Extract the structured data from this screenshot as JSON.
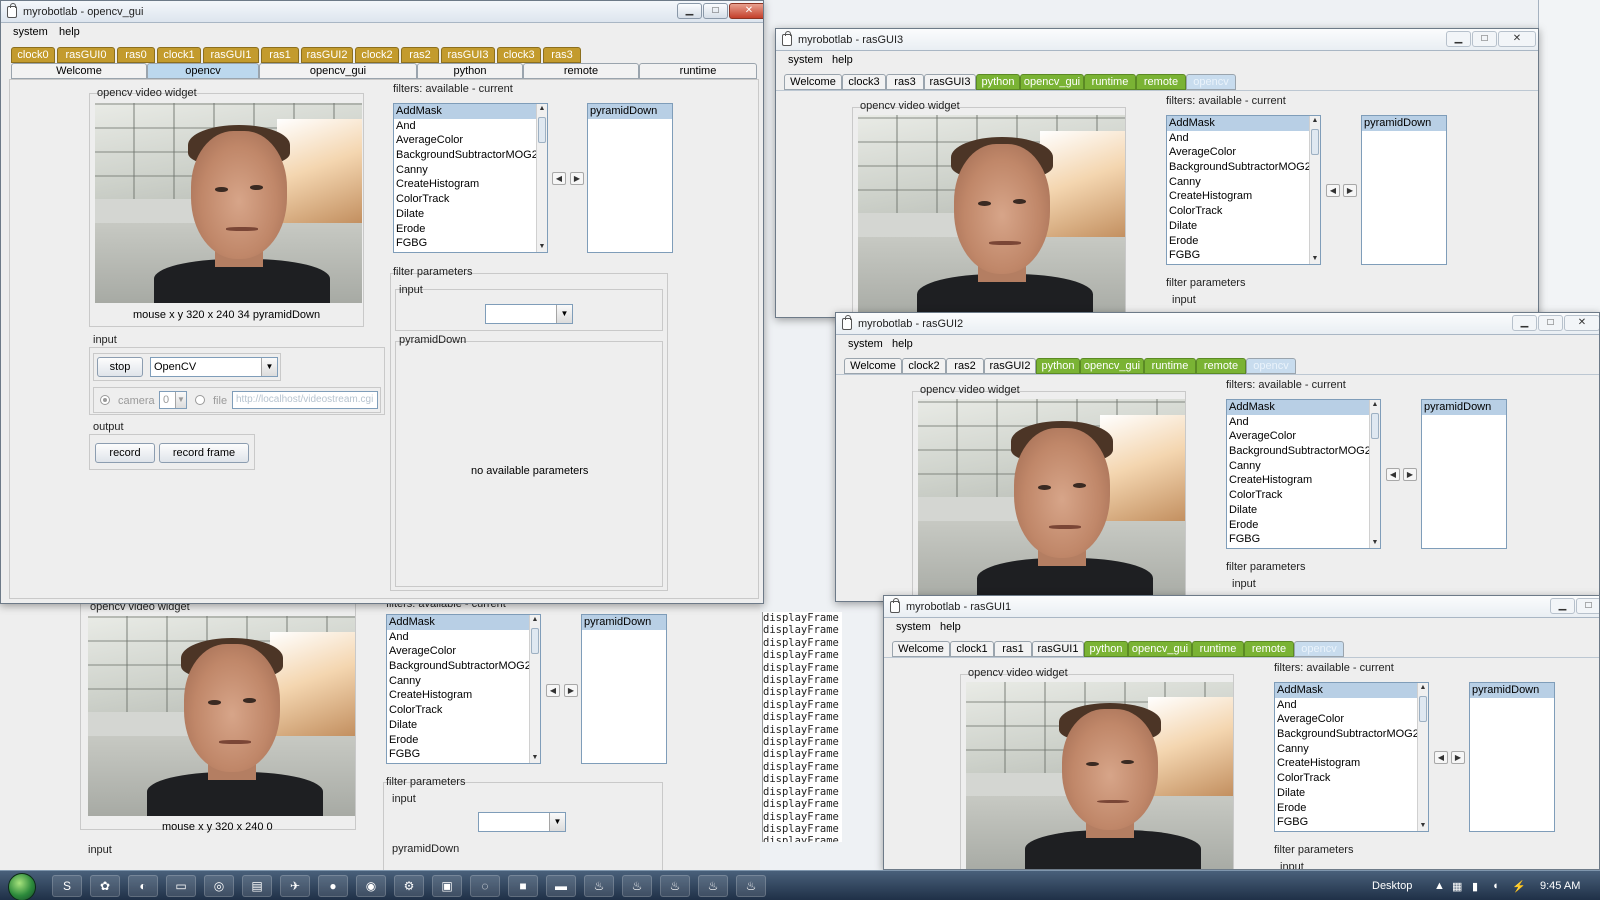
{
  "shared": {
    "system_menu": "system",
    "help_menu": "help",
    "video_widget_label": "opencv  video widget",
    "filters_label": "filters: available - current",
    "filter_params_label": "filter parameters",
    "input_label": "input",
    "output_label": "output",
    "current_filter": "pyramidDown",
    "filters": [
      "AddMask",
      "And",
      "AverageColor",
      "BackgroundSubtractorMOG2",
      "Canny",
      "CreateHistogram",
      "ColorTrack",
      "Dilate",
      "Erode",
      "FGBG"
    ],
    "no_params": "no available parameters",
    "stop_button": "stop",
    "capture_source": "OpenCV",
    "camera_label": "camera",
    "camera_index": "0",
    "file_label": "file",
    "file_url": "http://localhost/videostream.cgi",
    "record_button": "record",
    "record_frame_button": "record frame",
    "pyramid_section": "pyramidDown"
  },
  "main_window": {
    "title": "myrobotlab - opencv_gui",
    "service_tabs": [
      "clock0",
      "rasGUI0",
      "ras0",
      "clock1",
      "rasGUI1",
      "ras1",
      "rasGUI2",
      "clock2",
      "ras2",
      "rasGUI3",
      "clock3",
      "ras3"
    ],
    "tabs": [
      "Welcome",
      "opencv",
      "opencv_gui",
      "python",
      "remote",
      "runtime"
    ],
    "status": "mouse x y  320 x 240  34  pyramidDown"
  },
  "back_window": {
    "status": "mouse x y  320 x 240  0",
    "console_lines": [
      "displayFrame",
      "displayFrame",
      "displayFrame",
      "displayFrame",
      "displayFrame",
      "displayFrame",
      "displayFrame",
      "displayFrame",
      "displayFrame",
      "displayFrame",
      "displayFrame",
      "displayFrame",
      "displayFrame",
      "displayFrame",
      "displayFrame",
      "displayFrame",
      "displayFrame",
      "displayFrame",
      "displayFrame"
    ]
  },
  "win_ras3": {
    "title": "myrobotlab - rasGUI3",
    "tabs": [
      "Welcome",
      "clock3",
      "ras3",
      "rasGUI3",
      "python",
      "opencv_gui",
      "runtime",
      "remote",
      "opencv"
    ]
  },
  "win_ras2": {
    "title": "myrobotlab - rasGUI2",
    "tabs": [
      "Welcome",
      "clock2",
      "ras2",
      "rasGUI2",
      "python",
      "opencv_gui",
      "runtime",
      "remote",
      "opencv"
    ]
  },
  "win_ras1": {
    "title": "myrobotlab - rasGUI1",
    "tabs": [
      "Welcome",
      "clock1",
      "ras1",
      "rasGUI1",
      "python",
      "opencv_gui",
      "runtime",
      "remote",
      "opencv"
    ]
  },
  "taskbar": {
    "desktop_label": "Desktop",
    "clock": "9:45 AM"
  }
}
